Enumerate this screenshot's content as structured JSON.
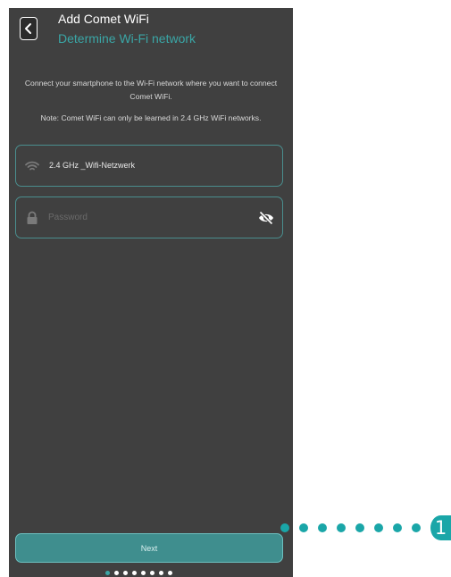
{
  "header": {
    "title": "Add Comet WiFi",
    "subtitle": "Determine Wi-Fi network"
  },
  "instructions": {
    "line1": "Connect your smartphone to the Wi-Fi network where you want to connect Comet WiFi.",
    "note": "Note: Comet WiFi can only be learned in 2.4 GHz WiFi networks."
  },
  "ssid_field": {
    "value": "2.4 GHz _Wifi-Netzwerk",
    "icon": "wifi-icon"
  },
  "password_field": {
    "placeholder": "Password",
    "value": "",
    "icon": "lock-icon",
    "toggle_icon": "eye-off-icon"
  },
  "next_button": {
    "label": "Next"
  },
  "pager": {
    "total": 8,
    "active_index": 0
  },
  "callout": {
    "number": "1",
    "color": "#1aa6a8"
  },
  "colors": {
    "background": "#404040",
    "accent": "#3aa6a6",
    "button": "#3f8e8e"
  }
}
